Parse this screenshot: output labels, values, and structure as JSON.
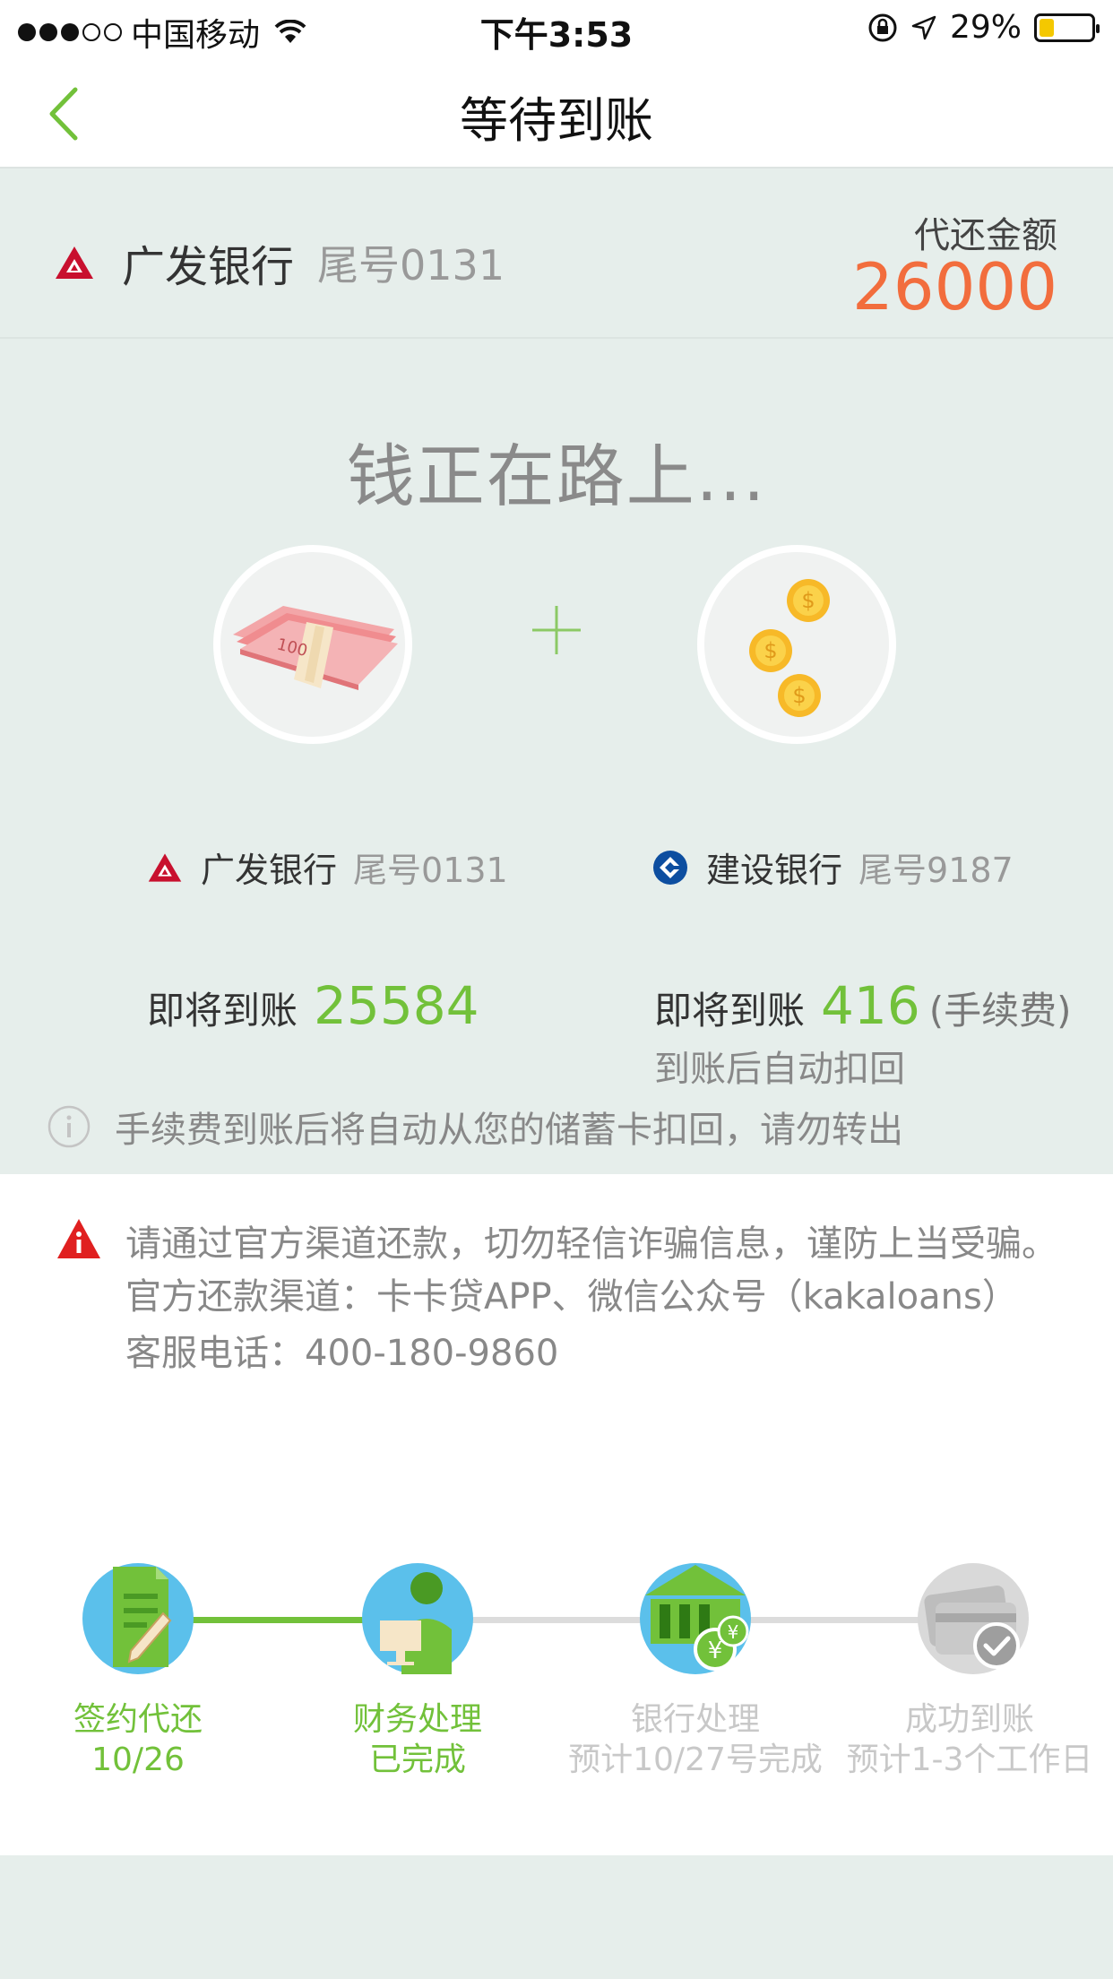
{
  "status_bar": {
    "carrier": "中国移动",
    "time": "下午3:53",
    "battery_percent": "29%",
    "battery_level": 0.29,
    "signal_bars_filled": 3,
    "signal_bars_total": 5
  },
  "nav": {
    "title": "等待到账",
    "back_icon": "chevron-left-icon"
  },
  "repay": {
    "bank_name": "广发银行",
    "tail": "尾号0131",
    "amount_label": "代还金额",
    "amount": "26000"
  },
  "flow": {
    "title": "钱正在路上...",
    "left": {
      "bank_name": "广发银行",
      "tail": "尾号0131",
      "arrive_label": "即将到账",
      "arrive_value": "25584"
    },
    "right": {
      "bank_name": "建设银行",
      "tail": "尾号9187",
      "arrive_label": "即将到账",
      "arrive_value": "416",
      "fee_note": "(手续费)",
      "auto_deduct": "到账后自动扣回"
    },
    "notice": "手续费到账后将自动从您的储蓄卡扣回，请勿转出"
  },
  "warning": {
    "line1": "请通过官方渠道还款，切勿轻信诈骗信息，谨防上当受骗。",
    "line2": "官方还款渠道：卡卡贷APP、微信公众号（kakaloans）",
    "line3": "客服电话：400-180-9860"
  },
  "steps": [
    {
      "title": "签约代还",
      "sub": "10/26",
      "done": true,
      "icon": "document-pen-icon"
    },
    {
      "title": "财务处理",
      "sub": "已完成",
      "done": true,
      "icon": "finance-worker-icon"
    },
    {
      "title": "银行处理",
      "sub": "预计10/27号完成",
      "done": false,
      "icon": "bank-building-icon"
    },
    {
      "title": "成功到账",
      "sub": "预计1-3个工作日",
      "done": false,
      "icon": "card-check-icon"
    }
  ],
  "colors": {
    "accent_green": "#72c13a",
    "amount_orange": "#f26d3d",
    "page_bg": "#e6eeeb",
    "cgb_red": "#c8102e",
    "ccb_blue": "#0d4ea0"
  }
}
